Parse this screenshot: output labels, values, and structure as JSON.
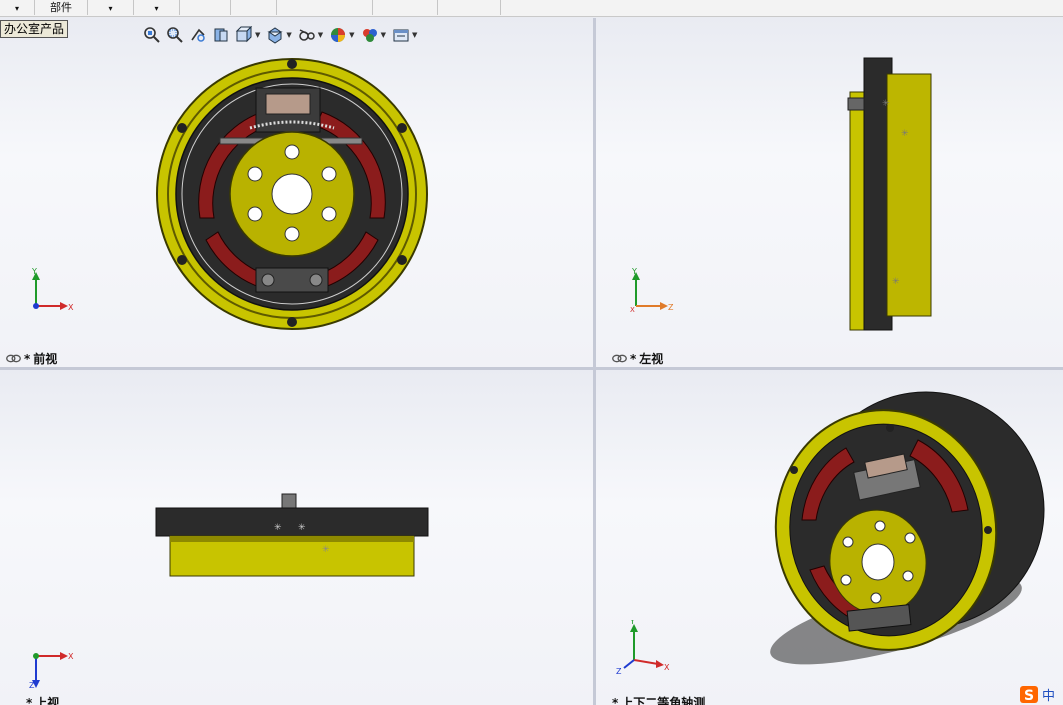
{
  "toolbar": {
    "items": [
      {
        "label": "",
        "arrow": "▾"
      },
      {
        "label": "部件",
        "arrow": ""
      },
      {
        "label": "",
        "arrow": "▾"
      },
      {
        "label": "",
        "arrow": "▾"
      },
      {
        "label": "",
        "arrow": ""
      },
      {
        "label": "",
        "arrow": ""
      },
      {
        "label": "",
        "arrow": ""
      },
      {
        "label": "",
        "arrow": ""
      },
      {
        "label": "",
        "arrow": ""
      }
    ]
  },
  "product_tag": "办公室产品",
  "hud_icons": [
    "zoom-to-fit-icon",
    "zoom-to-area-icon",
    "previous-view-icon",
    "section-view-icon",
    "view-orientation-icon",
    "display-style-icon",
    "hide-show-items-icon",
    "edit-appearance-icon",
    "apply-scene-icon",
    "view-settings-icon"
  ],
  "viewports": {
    "front": {
      "star": "*",
      "label": "前视"
    },
    "left": {
      "star": "*",
      "label": "左视"
    },
    "top": {
      "star": "*",
      "label": "上视"
    },
    "iso": {
      "star": "*",
      "label": "上下二等角轴测"
    }
  },
  "axes": {
    "x": "X",
    "y": "Y",
    "z": "Z"
  },
  "colors": {
    "rim": "#c8c400",
    "rim_dark": "#6f6b00",
    "shoe": "#8b1c1c",
    "drum_dark": "#2b2b2b",
    "hub": "#b9b200",
    "x_axis": "#d02a2a",
    "y_axis": "#1f9a2a",
    "z_axis": "#1f3bd0",
    "accent": "#ff6600"
  },
  "logo": {
    "glyph": "S",
    "text": "中"
  }
}
